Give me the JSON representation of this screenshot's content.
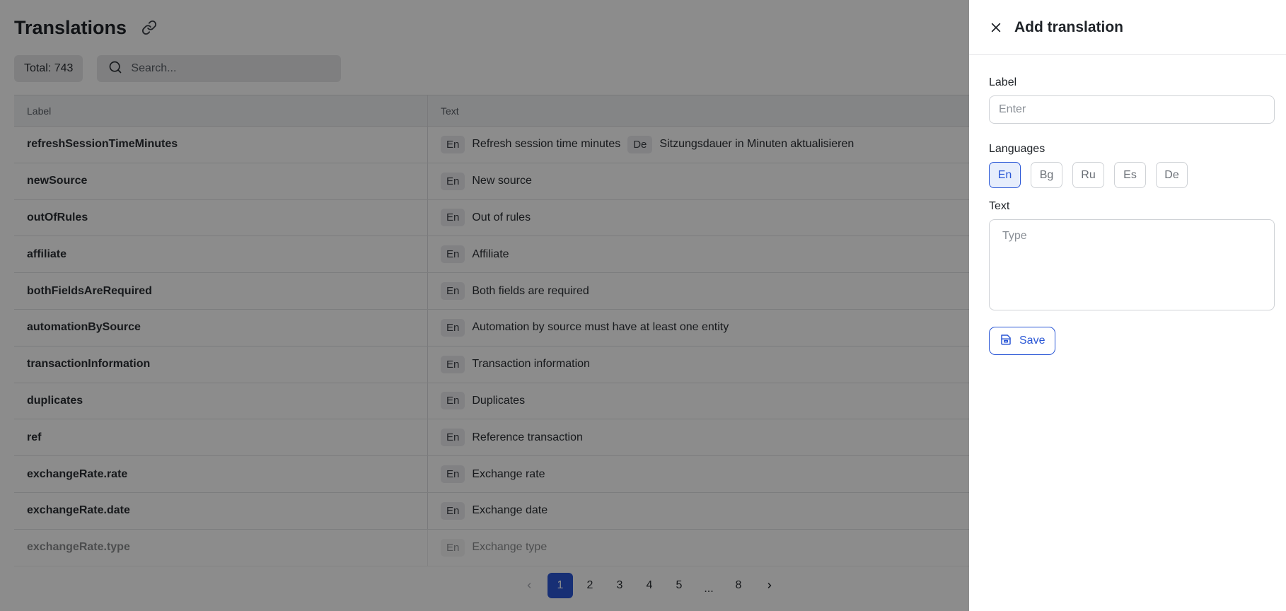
{
  "page": {
    "title": "Translations",
    "title_icon": "link-icon",
    "total_label": "Total: 743",
    "search": {
      "placeholder": "Search...",
      "value": ""
    }
  },
  "table": {
    "headers": {
      "label": "Label",
      "text": "Text"
    },
    "rows": [
      {
        "label": "refreshSessionTimeMinutes",
        "translations": [
          {
            "lang": "En",
            "text": "Refresh session time minutes"
          },
          {
            "lang": "De",
            "text": "Sitzungsdauer in Minuten aktualisieren"
          }
        ]
      },
      {
        "label": "newSource",
        "translations": [
          {
            "lang": "En",
            "text": "New source"
          }
        ]
      },
      {
        "label": "outOfRules",
        "translations": [
          {
            "lang": "En",
            "text": "Out of rules"
          }
        ]
      },
      {
        "label": "affiliate",
        "translations": [
          {
            "lang": "En",
            "text": "Affiliate"
          }
        ]
      },
      {
        "label": "bothFieldsAreRequired",
        "translations": [
          {
            "lang": "En",
            "text": "Both fields are required"
          }
        ]
      },
      {
        "label": "automationBySource",
        "translations": [
          {
            "lang": "En",
            "text": "Automation by source must have at least one entity"
          }
        ]
      },
      {
        "label": "transactionInformation",
        "translations": [
          {
            "lang": "En",
            "text": "Transaction information"
          }
        ]
      },
      {
        "label": "duplicates",
        "translations": [
          {
            "lang": "En",
            "text": "Duplicates"
          }
        ]
      },
      {
        "label": "ref",
        "translations": [
          {
            "lang": "En",
            "text": "Reference transaction"
          }
        ]
      },
      {
        "label": "exchangeRate.rate",
        "translations": [
          {
            "lang": "En",
            "text": "Exchange rate"
          }
        ]
      },
      {
        "label": "exchangeRate.date",
        "translations": [
          {
            "lang": "En",
            "text": "Exchange date"
          }
        ]
      },
      {
        "label": "exchangeRate.type",
        "translations": [
          {
            "lang": "En",
            "text": "Exchange type"
          }
        ]
      }
    ]
  },
  "pagination": {
    "pages": [
      "1",
      "2",
      "3",
      "4",
      "5",
      "...",
      "8"
    ],
    "current": "1",
    "prev_icon": "chevron-left-icon",
    "next_icon": "chevron-right-icon"
  },
  "drawer": {
    "title": "Add translation",
    "close_icon": "close-icon",
    "label_field": {
      "label": "Label",
      "placeholder": "Enter",
      "value": ""
    },
    "languages_label": "Languages",
    "languages": [
      {
        "code": "En",
        "selected": true
      },
      {
        "code": "Bg",
        "selected": false
      },
      {
        "code": "Ru",
        "selected": false
      },
      {
        "code": "Es",
        "selected": false
      },
      {
        "code": "De",
        "selected": false
      }
    ],
    "text_field": {
      "label": "Text",
      "placeholder": "Type",
      "value": ""
    },
    "save_label": "Save",
    "save_icon": "save-icon"
  },
  "colors": {
    "accent": "#2a57d6",
    "overlay": "rgba(0,0,0,0.45)"
  }
}
